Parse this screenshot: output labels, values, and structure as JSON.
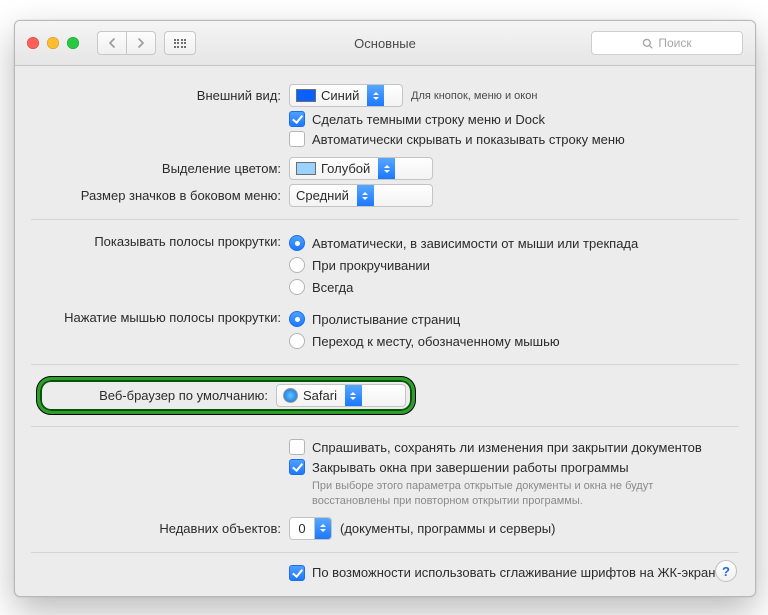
{
  "titlebar": {
    "title": "Основные",
    "search_placeholder": "Поиск"
  },
  "appearance": {
    "label": "Внешний вид:",
    "value": "Синий",
    "hint": "Для кнопок, меню и окон",
    "dark_menu_label": "Сделать темными строку меню и Dock",
    "dark_menu_checked": true,
    "autohide_label": "Автоматически скрывать и показывать строку меню",
    "autohide_checked": false
  },
  "highlight": {
    "label": "Выделение цветом:",
    "value": "Голубой"
  },
  "sidebar_icons": {
    "label": "Размер значков в боковом меню:",
    "value": "Средний"
  },
  "scrollbars": {
    "label": "Показывать полосы прокрутки:",
    "options": [
      "Автоматически, в зависимости от мыши или трекпада",
      "При прокручивании",
      "Всегда"
    ],
    "selected_index": 0
  },
  "scroll_click": {
    "label": "Нажатие мышью полосы прокрутки:",
    "options": [
      "Пролистывание страниц",
      "Переход к месту, обозначенному мышью"
    ],
    "selected_index": 0
  },
  "default_browser": {
    "label": "Веб-браузер по умолчанию:",
    "value": "Safari"
  },
  "documents": {
    "ask_save_label": "Спрашивать, сохранять ли изменения при закрытии документов",
    "ask_save_checked": false,
    "close_windows_label": "Закрывать окна при завершении работы программы",
    "close_windows_checked": true,
    "close_windows_hint": "При выборе этого параметра открытые документы и окна не будут восстановлены при повторном открытии программы."
  },
  "recent": {
    "label": "Недавних объектов:",
    "value": "0",
    "hint": "(документы, программы и серверы)"
  },
  "font_smoothing": {
    "label": "По возможности использовать сглаживание шрифтов на ЖК-экране",
    "checked": true
  },
  "help": "?"
}
